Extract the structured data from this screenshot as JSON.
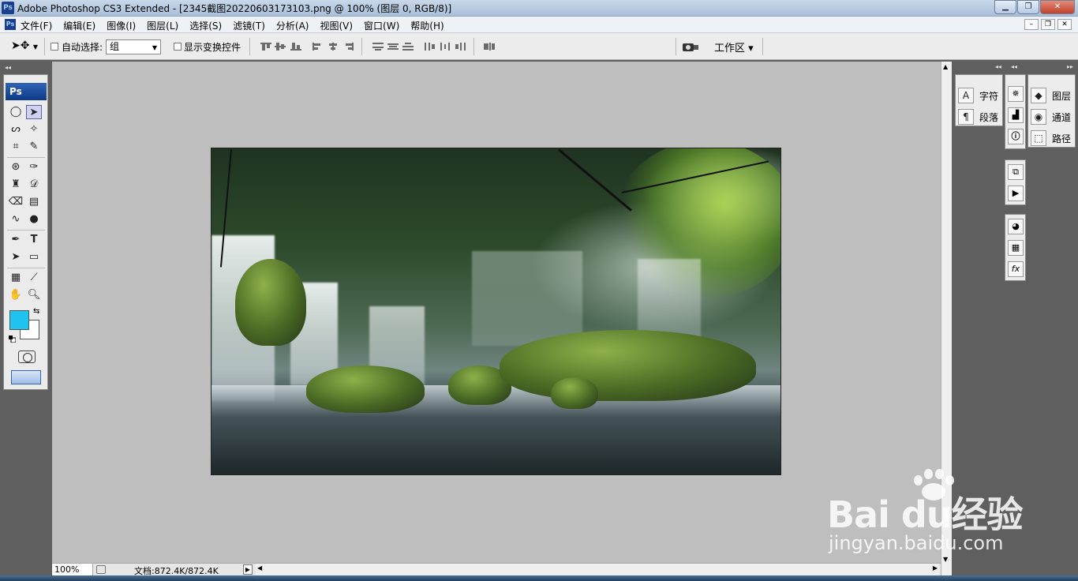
{
  "window": {
    "title": "Adobe Photoshop CS3 Extended - [2345截图20220603173103.png @ 100% (图层 0, RGB/8)]",
    "app_icon": "Ps",
    "controls": [
      "minimize",
      "maximize",
      "close"
    ]
  },
  "menubar": {
    "items": [
      "文件(F)",
      "编辑(E)",
      "图像(I)",
      "图层(L)",
      "选择(S)",
      "滤镜(T)",
      "分析(A)",
      "视图(V)",
      "窗口(W)",
      "帮助(H)"
    ]
  },
  "options": {
    "auto_select_label": "自动选择:",
    "auto_select_checked": false,
    "auto_select_value": "组",
    "show_transform_label": "显示变换控件",
    "show_transform_checked": false,
    "workspace_label": "工作区 ▾"
  },
  "toolbox": {
    "header": "Ps",
    "tools": [
      "marquee",
      "move",
      "lasso",
      "magic-wand",
      "crop",
      "slice",
      "healing",
      "brush",
      "clone-stamp",
      "history-brush",
      "eraser",
      "gradient",
      "blur",
      "dodge",
      "pen",
      "type",
      "path-select",
      "shape",
      "notes",
      "eyedropper",
      "hand",
      "zoom"
    ],
    "active_tool": "move",
    "foreground_color": "#1fc3f0",
    "background_color": "#ffffff"
  },
  "statusbar": {
    "zoom": "100%",
    "doc_info": "文档:872.4K/872.4K"
  },
  "panels": {
    "group1": [
      {
        "icon": "character-icon",
        "glyph": "A",
        "label": "字符"
      },
      {
        "icon": "paragraph-icon",
        "glyph": "¶",
        "label": "段落"
      }
    ],
    "group3": [
      {
        "icon": "layers-icon",
        "label": "图层"
      },
      {
        "icon": "channels-icon",
        "label": "通道"
      },
      {
        "icon": "paths-icon",
        "label": "路径"
      }
    ]
  },
  "watermark": {
    "main": "Bai du经验",
    "sub": "jingyan.baidu.com"
  }
}
